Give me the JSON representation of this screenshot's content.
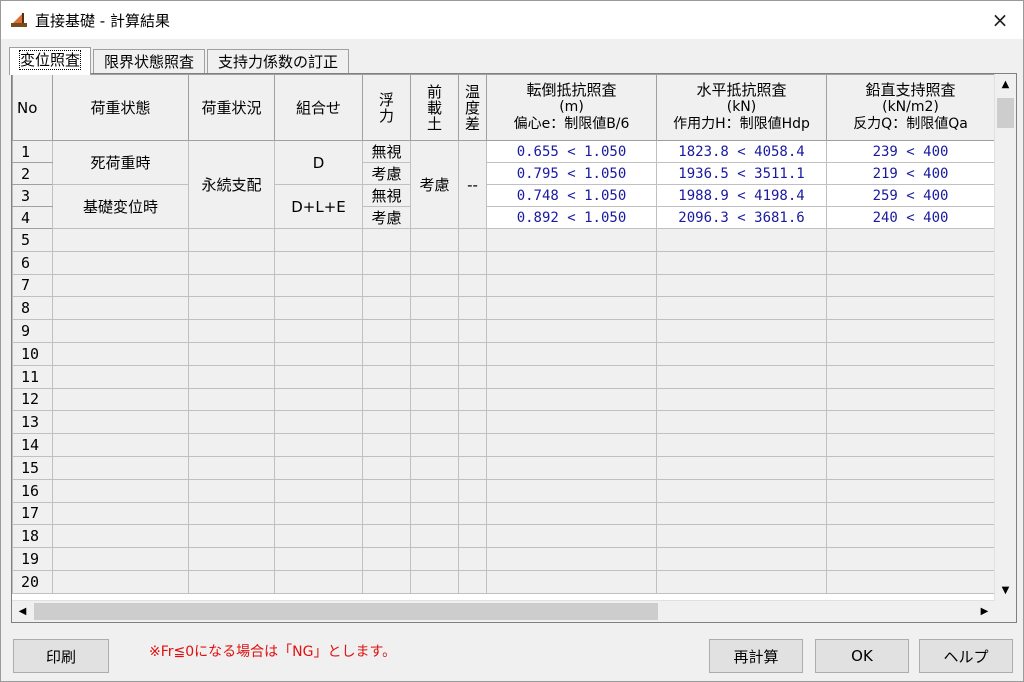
{
  "window": {
    "title": "直接基礎 - 計算結果",
    "close_icon": "×"
  },
  "tabs": [
    {
      "label": "変位照査",
      "active": true
    },
    {
      "label": "限界状態照査",
      "active": false
    },
    {
      "label": "支持力係数の訂正",
      "active": false
    }
  ],
  "grid": {
    "headers": {
      "no": "No",
      "load_state": "荷重状態",
      "load_condition": "荷重状況",
      "combination": "組合せ",
      "buoyancy": [
        "浮",
        "力"
      ],
      "surcharge": [
        "前",
        "載",
        "土"
      ],
      "temp_diff": [
        "温",
        "度",
        "差"
      ],
      "overturning": {
        "title": "転倒抵抗照査",
        "unit": "(m)",
        "sub": "偏心e：制限値B/6"
      },
      "horizontal": {
        "title": "水平抵抗照査",
        "unit": "(kN)",
        "sub": "作用力H：制限値Hdp"
      },
      "vertical": {
        "title": "鉛直支持照査",
        "unit": "(kN/m2)",
        "sub": "反力Q：制限値Qa"
      }
    },
    "groups": {
      "state_a": "死荷重時",
      "state_b": "基礎変位時",
      "condition": "永続支配",
      "combo_a": "D",
      "combo_b": "D+L+E",
      "surcharge": "考慮",
      "temp_diff": "--"
    },
    "rows": [
      {
        "no": "1",
        "buoyancy": "無視",
        "overturning": "0.655 < 1.050",
        "horizontal": "1823.8 < 4058.4",
        "vertical": "239 < 400"
      },
      {
        "no": "2",
        "buoyancy": "考慮",
        "overturning": "0.795 < 1.050",
        "horizontal": "1936.5 < 3511.1",
        "vertical": "219 < 400"
      },
      {
        "no": "3",
        "buoyancy": "無視",
        "overturning": "0.748 < 1.050",
        "horizontal": "1988.9 < 4198.4",
        "vertical": "259 < 400"
      },
      {
        "no": "4",
        "buoyancy": "考慮",
        "overturning": "0.892 < 1.050",
        "horizontal": "2096.3 < 3681.6",
        "vertical": "240 < 400"
      }
    ],
    "empty_rows": [
      "5",
      "6",
      "7",
      "8",
      "9",
      "10",
      "11",
      "12",
      "13",
      "14",
      "15",
      "16",
      "17",
      "18",
      "19",
      "20"
    ]
  },
  "footer": {
    "print_label": "印刷",
    "note": "※Fr≦0になる場合は「NG」とします。",
    "recalc_label": "再計算",
    "ok_label": "OK",
    "help_label": "ヘルプ"
  },
  "colors": {
    "value_text": "#1a1aa0",
    "note_text": "#e01010"
  }
}
